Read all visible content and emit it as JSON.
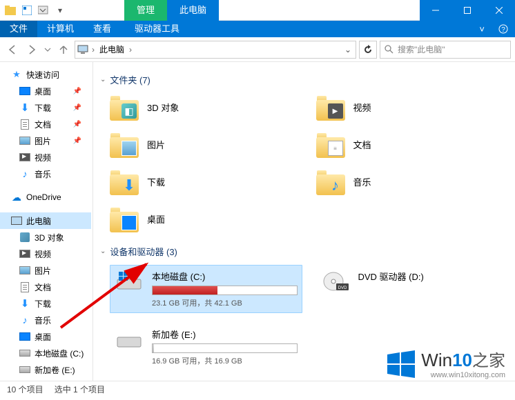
{
  "titlebar": {
    "manage_tab": "管理",
    "context_tab": "此电脑"
  },
  "ribbon": {
    "file": "文件",
    "computer": "计算机",
    "view": "查看",
    "drive_tools": "驱动器工具"
  },
  "nav": {
    "breadcrumb": "此电脑",
    "search_placeholder": "搜索\"此电脑\""
  },
  "sidebar": {
    "quick_access": "快速访问",
    "desktop": "桌面",
    "downloads": "下载",
    "documents": "文档",
    "pictures": "图片",
    "videos": "视频",
    "music": "音乐",
    "onedrive": "OneDrive",
    "this_pc": "此电脑",
    "3d_objects": "3D 对象",
    "videos2": "视频",
    "pictures2": "图片",
    "documents2": "文档",
    "downloads2": "下载",
    "music2": "音乐",
    "desktop2": "桌面",
    "local_disk_c": "本地磁盘 (C:)",
    "new_volume_e": "新加卷 (E:)"
  },
  "content": {
    "folders_header": "文件夹 (7)",
    "drives_header": "设备和驱动器 (3)",
    "folders": {
      "objects3d": "3D 对象",
      "videos": "视频",
      "pictures": "图片",
      "documents": "文档",
      "downloads": "下载",
      "music": "音乐",
      "desktop": "桌面"
    },
    "drives": {
      "c": {
        "title": "本地磁盘 (C:)",
        "sub": "23.1 GB 可用，共 42.1 GB",
        "fill_pct": 45,
        "fill_color": "red"
      },
      "e": {
        "title": "新加卷 (E:)",
        "sub": "16.9 GB 可用，共 16.9 GB",
        "fill_pct": 1,
        "fill_color": "gray"
      },
      "d": {
        "title": "DVD 驱动器 (D:)"
      }
    }
  },
  "statusbar": {
    "items": "10 个项目",
    "selected": "选中 1 个项目"
  },
  "watermark": {
    "brand_prefix": "Win",
    "brand_ten": "10",
    "brand_suffix": "之家",
    "url": "www.win10xitong.com"
  }
}
